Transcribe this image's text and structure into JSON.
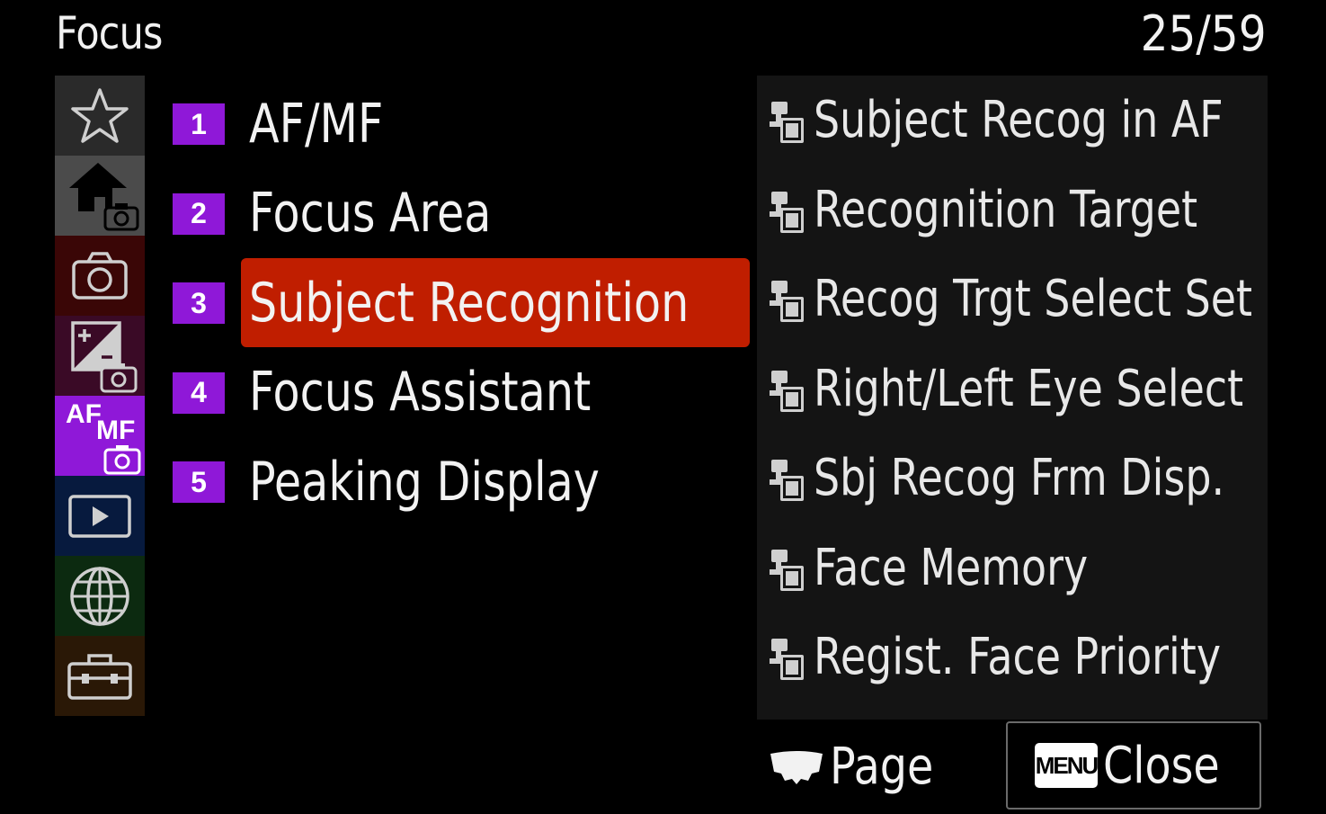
{
  "header": {
    "title": "Focus",
    "page_counter": "25/59"
  },
  "sidebar": {
    "tabs": [
      {
        "icon": "star-icon"
      },
      {
        "icon": "home-camera-icon"
      },
      {
        "icon": "camera-icon"
      },
      {
        "icon": "exposure-camera-icon"
      },
      {
        "icon": "af-mf-camera-icon",
        "af": "AF",
        "mf": "MF",
        "active": true
      },
      {
        "icon": "playback-icon"
      },
      {
        "icon": "globe-icon"
      },
      {
        "icon": "toolbox-icon"
      }
    ]
  },
  "pages": [
    {
      "number": "1",
      "label": "AF/MF"
    },
    {
      "number": "2",
      "label": "Focus Area"
    },
    {
      "number": "3",
      "label": "Subject Recognition",
      "selected": true
    },
    {
      "number": "4",
      "label": "Focus Assistant"
    },
    {
      "number": "5",
      "label": "Peaking Display"
    }
  ],
  "panel": {
    "items": [
      {
        "label": "Subject Recog in AF",
        "icon": "still-movie-icon"
      },
      {
        "label": "Recognition Target",
        "icon": "still-movie-icon"
      },
      {
        "label": "Recog Trgt Select Set",
        "icon": "still-movie-icon"
      },
      {
        "label": "Right/Left Eye Select",
        "icon": "still-movie-icon"
      },
      {
        "label": "Sbj Recog Frm Disp.",
        "icon": "still-movie-icon"
      },
      {
        "label": "Face Memory",
        "icon": "still-movie-icon"
      },
      {
        "label": "Regist. Face Priority",
        "icon": "still-movie-icon"
      }
    ]
  },
  "footer": {
    "page_label": "Page",
    "menu_badge": "MENU",
    "close_label": "Close"
  },
  "colors": {
    "accent_purple": "#8f18d8",
    "selection_red": "#c01e00",
    "panel_bg": "#141414"
  }
}
